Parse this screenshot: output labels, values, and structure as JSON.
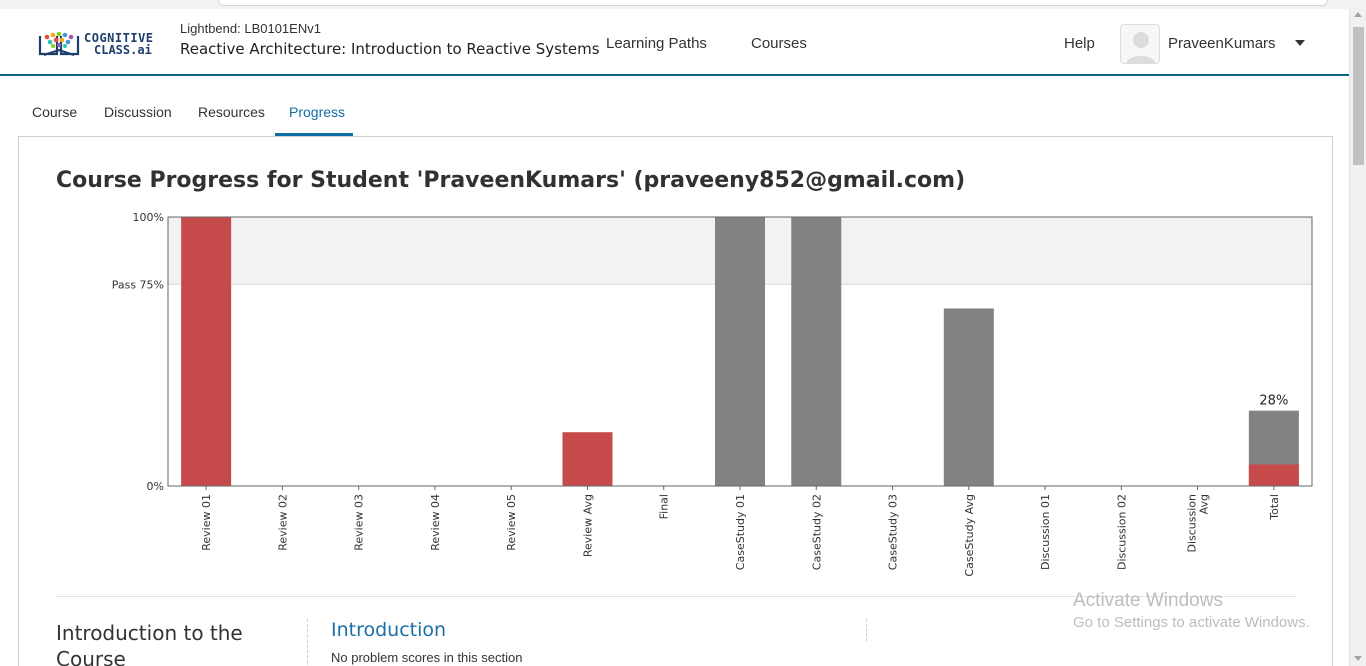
{
  "header": {
    "logo": {
      "line1": "COGNITIVE",
      "line2": "CLASS.ai",
      "icon": "cognitive-class-logo-icon"
    },
    "course_org": "Lightbend: LB0101ENv1",
    "course_title": "Reactive Architecture: Introduction to Reactive Systems",
    "nav": [
      "Learning Paths",
      "Courses"
    ],
    "help": "Help",
    "username": "PraveenKumars",
    "user_menu_icon": "chevron-down-icon",
    "avatar_icon": "user-avatar-icon"
  },
  "tabs": [
    {
      "label": "Course",
      "active": false
    },
    {
      "label": "Discussion",
      "active": false
    },
    {
      "label": "Resources",
      "active": false
    },
    {
      "label": "Progress",
      "active": true
    }
  ],
  "page": {
    "title": "Course Progress for Student 'PraveenKumars' (praveeny852@gmail.com)"
  },
  "chart_data": {
    "type": "bar",
    "title": "",
    "ylim": [
      0,
      100
    ],
    "y_ticks": [
      {
        "value": 100,
        "label": "100%"
      },
      {
        "value": 75,
        "label": "Pass 75%"
      },
      {
        "value": 0,
        "label": "0%"
      }
    ],
    "pass_band": [
      75,
      100
    ],
    "categories": [
      [
        "Review 01"
      ],
      [
        "Review 02"
      ],
      [
        "Review 03"
      ],
      [
        "Review 04"
      ],
      [
        "Review 05"
      ],
      [
        "Review Avg"
      ],
      [
        "Final"
      ],
      [
        "CaseStudy 01"
      ],
      [
        "CaseStudy 02"
      ],
      [
        "CaseStudy 03"
      ],
      [
        "CaseStudy Avg"
      ],
      [
        "Discussion 01"
      ],
      [
        "Discussion 02"
      ],
      [
        "Discussion",
        "Avg"
      ],
      [
        "Total"
      ]
    ],
    "values": [
      100,
      0,
      0,
      0,
      0,
      20,
      0,
      100,
      100,
      0,
      66,
      0,
      0,
      0,
      28
    ],
    "bar_colors": [
      "#c74a4b",
      "#c74a4b",
      "#c74a4b",
      "#c74a4b",
      "#c74a4b",
      "#c74a4b",
      "#828282",
      "#828282",
      "#828282",
      "#828282",
      "#828282",
      "#828282",
      "#828282",
      "#828282",
      "#828282"
    ],
    "total_split": {
      "index": 14,
      "earned": 8,
      "earned_color": "#c74a4b",
      "rest_color": "#828282"
    },
    "data_labels": [
      {
        "index": 14,
        "label": "28%"
      }
    ],
    "colors": {
      "review": "#c74a4b",
      "other": "#828282",
      "band": "#f2f2f2",
      "frame": "#666666"
    },
    "grid": false
  },
  "sections": [
    {
      "name": "Introduction to the Course",
      "subsections": [
        {
          "title": "Introduction",
          "status": "No problem scores in this section"
        }
      ]
    }
  ],
  "watermark": {
    "line1": "Activate Windows",
    "line2": "Go to Settings to activate Windows."
  }
}
